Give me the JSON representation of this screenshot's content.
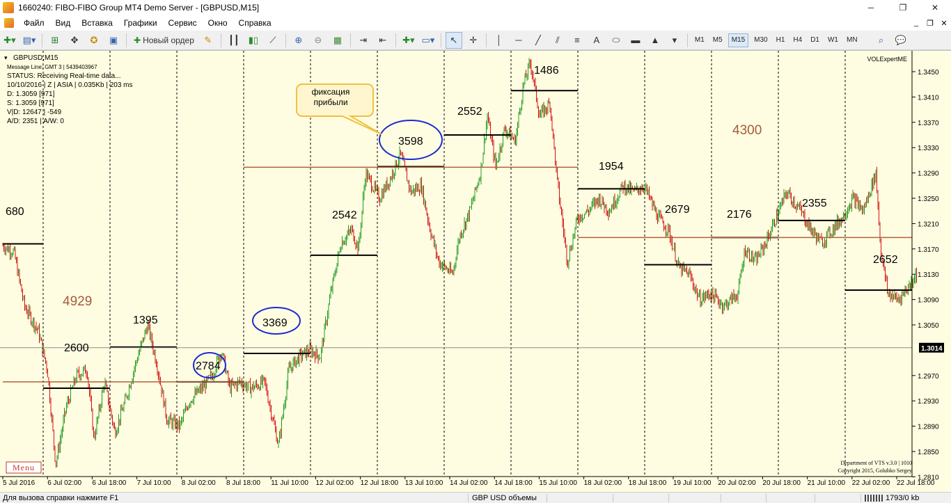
{
  "window": {
    "title": "1660240: FIBO-FIBO Group MT4 Demo Server - [GBPUSD,M15]",
    "minimize": "─",
    "maximize": "❐",
    "close": "✕"
  },
  "menu": [
    "Файл",
    "Вид",
    "Вставка",
    "Графики",
    "Сервис",
    "Окно",
    "Справка"
  ],
  "mdi": {
    "minimize": "_",
    "restore": "❐",
    "close": "✕"
  },
  "toolbar": {
    "new_order_label": "Новый ордер",
    "timeframes": [
      "M1",
      "M5",
      "M15",
      "M30",
      "H1",
      "H4",
      "D1",
      "W1",
      "MN"
    ],
    "active_timeframe": "M15",
    "tools": {
      "text_tool": "A"
    }
  },
  "chart": {
    "symbol_label": "GBPUSD,M15",
    "info_lines": [
      "Message Line: GMT 3 | 5439403967",
      "STATUS:  Receiving Real-time data...",
      "10/10/2016 | Z | ASIA | 0.035Kb | 203 ms",
      "D: 1.3059 [971]",
      "S: 1.3059 [971]",
      "V|D: 12647 | -549",
      "A/D: 2351 | A/W: 0"
    ],
    "indicator_name": "VOLExpertME",
    "copyright_lines": [
      "Department of VTS  v.3.0 | 1010",
      "Copyright 2015, Golubko Sergey"
    ],
    "menu_button": "Menu",
    "current_price": "1.3014",
    "price_ticks": [
      "1.3450",
      "1.3410",
      "1.3370",
      "1.3330",
      "1.3290",
      "1.3250",
      "1.3210",
      "1.3170",
      "1.3130",
      "1.3090",
      "1.3050",
      "1.2970",
      "1.2930",
      "1.2890",
      "1.2850",
      "1.2810"
    ],
    "time_ticks": [
      "5 Jul 2016",
      "6 Jul 02:00",
      "6 Jul 18:00",
      "7 Jul 10:00",
      "8 Jul 02:00",
      "8 Jul 18:00",
      "11 Jul 10:00",
      "12 Jul 02:00",
      "12 Jul 18:00",
      "13 Jul 10:00",
      "14 Jul 02:00",
      "14 Jul 18:00",
      "15 Jul 10:00",
      "18 Jul 02:00",
      "18 Jul 18:00",
      "19 Jul 10:00",
      "20 Jul 02:00",
      "20 Jul 18:00",
      "21 Jul 10:00",
      "22 Jul 02:00",
      "22 Jul 18:00"
    ],
    "volume_labels": [
      "680",
      "2600",
      "1395",
      "2784",
      "3369",
      "2542",
      "3598",
      "2552",
      "1486",
      "1954",
      "2679",
      "2176",
      "2355",
      "2652"
    ],
    "large_labels": [
      "4929",
      "4300"
    ],
    "callout": [
      "фиксация",
      "прибыли"
    ],
    "colors": {
      "background": "#fffde1",
      "bull": "#1f9a1f",
      "bear": "#d01010",
      "level": "#000000",
      "trend": "#b0603a",
      "ellipse": "#1a2ad4",
      "big_number": "#a55a3c"
    }
  },
  "status": {
    "help": "Для вызова справки нажмите F1",
    "profile": "GBP USD объемы",
    "connection": "1793/0 kb"
  }
}
